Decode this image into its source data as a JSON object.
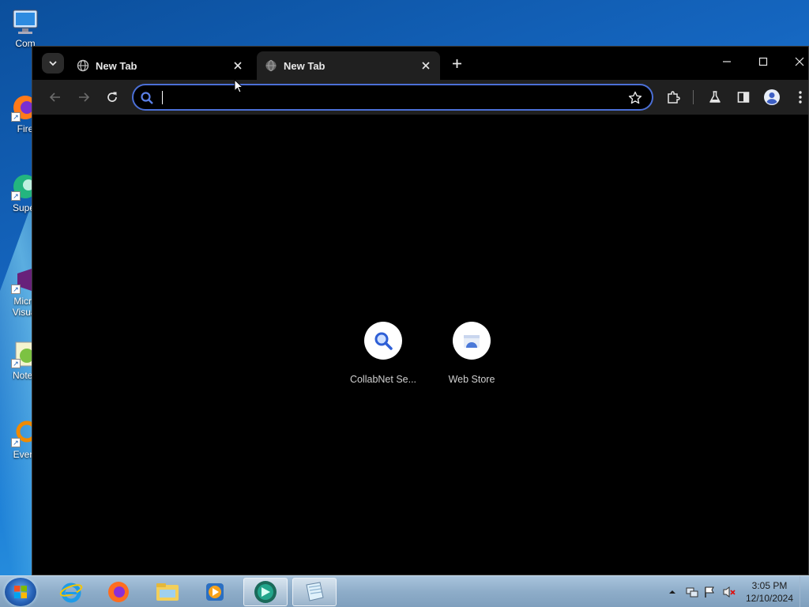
{
  "desktop": {
    "icons": [
      {
        "label": "Com"
      },
      {
        "label": "Fire"
      },
      {
        "label": "Super"
      },
      {
        "label": "Micro\nVisual"
      },
      {
        "label": "Notep"
      },
      {
        "label": "Every"
      }
    ]
  },
  "browser": {
    "tabs": [
      {
        "title": "New Tab",
        "state": "inactive"
      },
      {
        "title": "New Tab",
        "state": "active"
      }
    ],
    "omnibox": {
      "value": "",
      "placeholder": ""
    },
    "accent_color": "#4b6fd6",
    "shortcuts": [
      {
        "label": "CollabNet Se...",
        "icon": "magnifier-icon"
      },
      {
        "label": "Web Store",
        "icon": "web-store-icon"
      }
    ]
  },
  "taskbar": {
    "apps": [
      "internet-explorer-icon",
      "firefox-icon",
      "file-explorer-icon",
      "media-player-icon",
      "browser-icon",
      "notepad-icon"
    ],
    "clock": {
      "time": "3:05 PM",
      "date": "12/10/2024"
    }
  }
}
